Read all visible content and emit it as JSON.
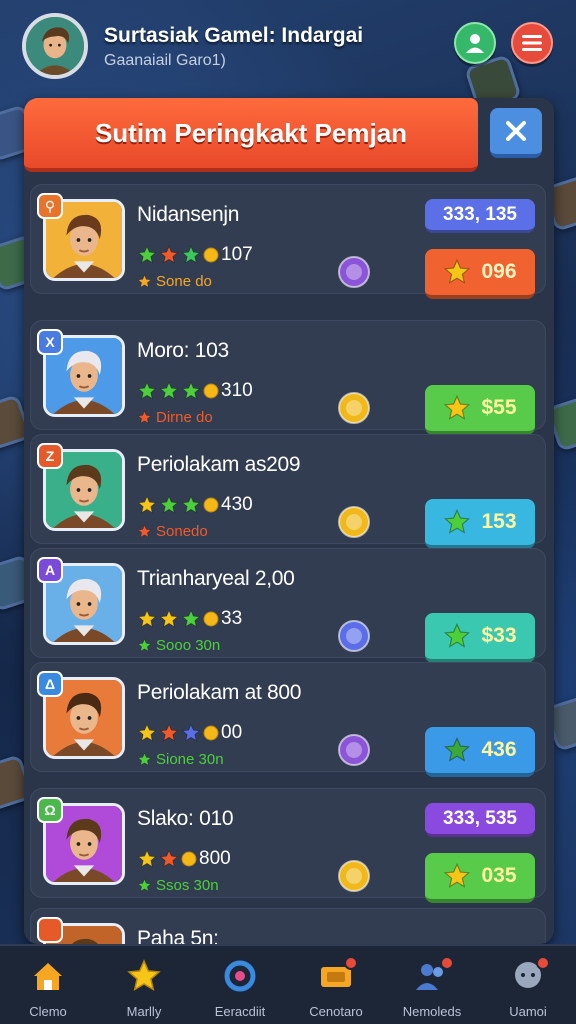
{
  "header": {
    "player_name": "Surtasiak Gamel: Indargai",
    "player_sub": "Gaanaiail Garo1)",
    "friend_icon": "user-icon",
    "menu_icon": "hamburger-icon"
  },
  "panel": {
    "title": "Sutim Peringkakt Pemjan",
    "close_icon": "close-icon"
  },
  "rows": [
    {
      "name": "Nidansenjn",
      "stat_value": "107",
      "sub": "Sone do",
      "score": "333, 135",
      "action": "096",
      "badge": "⚲",
      "badge_color": "#e8732a",
      "pill_color": "#5b6fe6",
      "btn_color": "#f0622f",
      "mid_color": "#8a55d8",
      "avatar_bg": "#f2b23a"
    },
    {
      "name": "Moro: 103",
      "stat_value": "310",
      "sub": "Dirne do",
      "action": "$55",
      "badge": "X",
      "badge_color": "#4a7be0",
      "btn_color": "#58cc4a",
      "mid_color": "#f0b81a",
      "avatar_bg": "#4c9ae8"
    },
    {
      "name": "Periolakam as209",
      "stat_value": "430",
      "sub": "Sonedo",
      "action": "153",
      "badge": "Z",
      "badge_color": "#e65a2a",
      "btn_color": "#38b8e0",
      "mid_color": "#f0b81a",
      "avatar_bg": "#3ab08a"
    },
    {
      "name": "Trianharyeal 2,00",
      "stat_value": "33",
      "sub": "Sooo 30n",
      "action": "$33",
      "badge": "A",
      "badge_color": "#7a4ad8",
      "btn_color": "#3ac8b0",
      "mid_color": "#5b6ee8",
      "avatar_bg": "#6ab0e8"
    },
    {
      "name": "Periolakam at 800",
      "stat_value": "00",
      "sub": "Sione 30n",
      "action": "436",
      "badge": "Δ",
      "badge_color": "#3a8ae0",
      "btn_color": "#3a9ae8",
      "mid_color": "#8a55d8",
      "avatar_bg": "#e87a3a"
    },
    {
      "name": "Slako: 010",
      "stat_value": "800",
      "sub": "Ssos 30n",
      "score": "333, 535",
      "action": "035",
      "badge": "Ω",
      "badge_color": "#4ab84a",
      "pill_color": "#8a4ae0",
      "btn_color": "#58cc4a",
      "mid_color": "#f0b81a",
      "avatar_bg": "#b04ad8"
    },
    {
      "name": "Paha 5n:",
      "badge": "",
      "badge_color": "#e65a2a",
      "avatar_bg": "#c0642a"
    }
  ],
  "nav": [
    {
      "label": "Clemo",
      "icon": "home-icon",
      "color": "#f5a623",
      "dot": false
    },
    {
      "label": "Marlly",
      "icon": "star-icon",
      "color": "#f5c518",
      "dot": false
    },
    {
      "label": "Eeracdiit",
      "icon": "swirl-icon",
      "color": "#3a8ae0",
      "dot": false
    },
    {
      "label": "Cenotaro",
      "icon": "ticket-icon",
      "color": "#f5a623",
      "dot": true
    },
    {
      "label": "Nemoleds",
      "icon": "people-icon",
      "color": "#4a7bd0",
      "dot": true
    },
    {
      "label": "Uamoi",
      "icon": "chat-icon",
      "color": "#9aa7bd",
      "dot": true
    }
  ]
}
